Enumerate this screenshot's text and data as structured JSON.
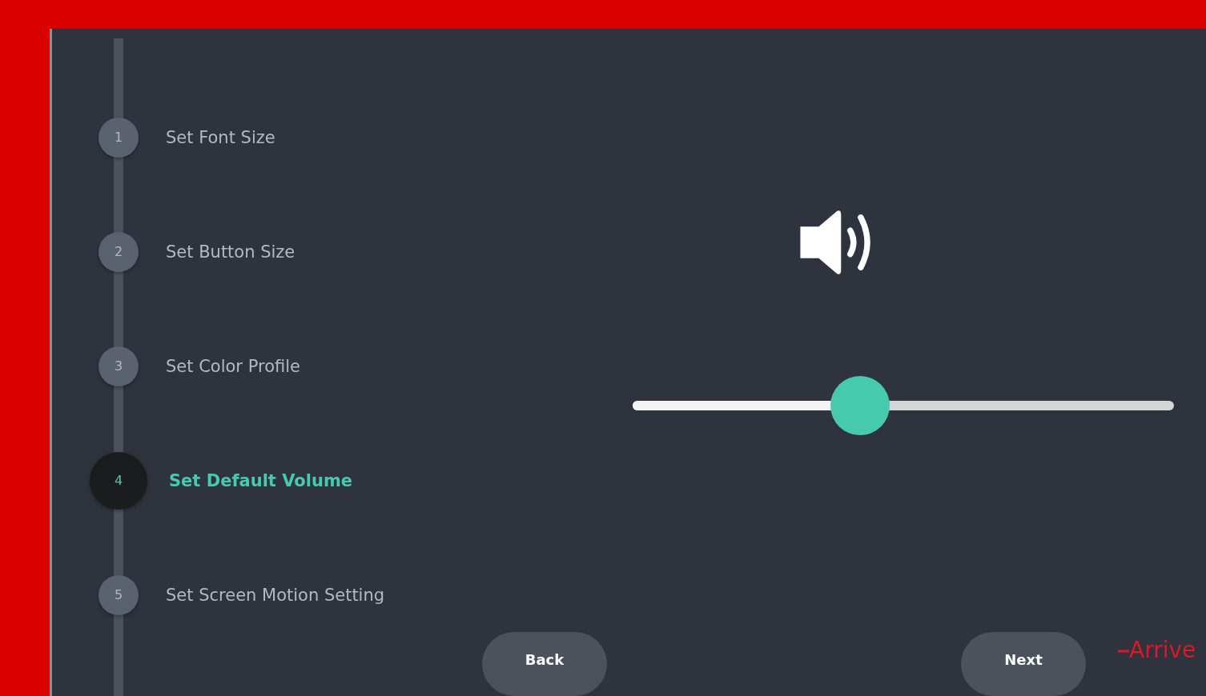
{
  "steps": [
    {
      "number": "1",
      "label": "Set Font Size",
      "selected": false
    },
    {
      "number": "2",
      "label": "Set Button Size",
      "selected": false
    },
    {
      "number": "3",
      "label": "Set Color Profile",
      "selected": false
    },
    {
      "number": "4",
      "label": "Set Default Volume",
      "selected": true
    },
    {
      "number": "5",
      "label": "Set Screen Motion Setting",
      "selected": false
    }
  ],
  "volume_slider": {
    "level": 0.42
  },
  "buttons": [
    {
      "label": "Back"
    },
    {
      "label": "Next"
    }
  ],
  "logo": {
    "text": "Arrive"
  }
}
